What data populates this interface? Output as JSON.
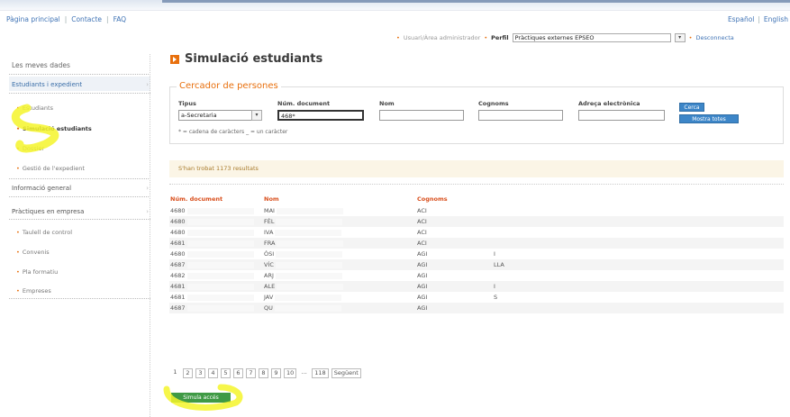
{
  "top": {
    "links": [
      "Pàgina principal",
      "Contacte",
      "FAQ"
    ],
    "languages": [
      "Español",
      "English"
    ]
  },
  "userbar": {
    "user_label": "Usuari/Àrea administrador",
    "profile_label": "Perfil",
    "profile_value": "Pràctiques externes EPSEO",
    "logout": "Desconnecta"
  },
  "sidebar": {
    "title": "Les meves dades",
    "sections": [
      {
        "label": "Estudiants i expedient",
        "items": [
          "Estudiants",
          "Simulació estudiants",
          "Dossier",
          "Gestió de l'expedient"
        ]
      },
      {
        "label": "Informació general",
        "items": []
      },
      {
        "label": "Pràctiques en empresa",
        "items": [
          "Taulell de control",
          "Convenis",
          "Pla formatiu",
          "Empreses"
        ]
      }
    ]
  },
  "main": {
    "title": "Simulació estudiants",
    "search": {
      "legend": "Cercador de persones",
      "labels": {
        "tipus": "Tipus",
        "document": "Núm. document",
        "nom": "Nom",
        "cognoms": "Cognoms",
        "email": "Adreça electrònica"
      },
      "tipus_value": "a-Secretaria",
      "document_value": "468*",
      "hint": "* = cadena de caràcters _ = un caràcter",
      "search_button": "Cerca",
      "show_all_button": "Mostra totes"
    },
    "results_text": "S'han trobat 1173 resultats",
    "table": {
      "headers": [
        "Núm. document",
        "Nom",
        "Cognoms",
        ""
      ],
      "rows": [
        [
          "4680",
          "MAI",
          "ACI",
          ""
        ],
        [
          "4680",
          "FÈL",
          "ACI",
          ""
        ],
        [
          "4680",
          "IVA",
          "ACI",
          ""
        ],
        [
          "4681",
          "FRA",
          "ACI",
          ""
        ],
        [
          "4680",
          "ÓSI",
          "AGI",
          "I"
        ],
        [
          "4687",
          "VÍC",
          "AGI",
          "LLA"
        ],
        [
          "4682",
          "ARJ",
          "AGI",
          ""
        ],
        [
          "4681",
          "ALE",
          "AGI",
          "I"
        ],
        [
          "4681",
          "JAV",
          "AGI",
          "S"
        ],
        [
          "4687",
          "QU",
          "AGI",
          ""
        ]
      ]
    },
    "pager": {
      "pages": [
        "1",
        "2",
        "3",
        "4",
        "5",
        "6",
        "7",
        "8",
        "9",
        "10",
        "...",
        "118"
      ],
      "next": "Següent"
    },
    "simulate_button": "Simula accés"
  },
  "colors": {
    "accent_orange": "#e8700e",
    "link_blue": "#3f73b5",
    "header_red": "#d9501e",
    "button_blue": "#3d86c8",
    "button_green": "#3f9a45",
    "highlight_yellow": "#f5f52a"
  }
}
